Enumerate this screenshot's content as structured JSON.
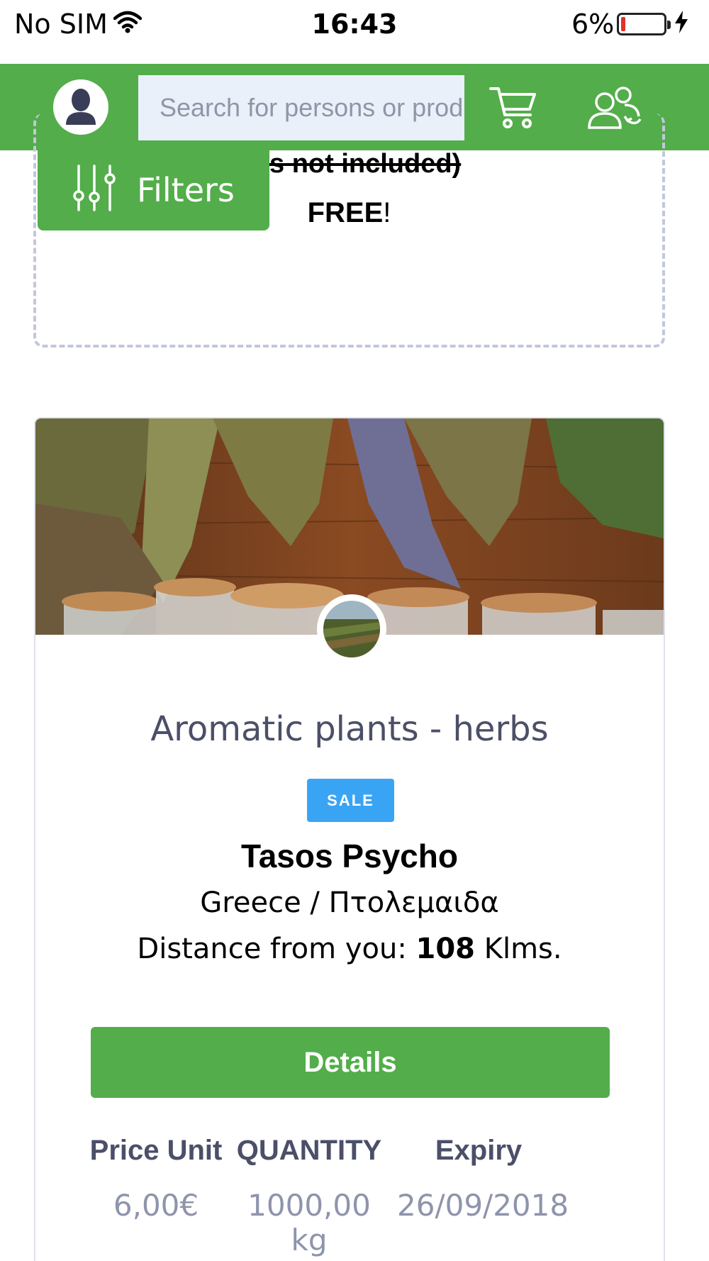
{
  "status_bar": {
    "carrier": "No SIM",
    "time": "16:43",
    "battery_percent": "6%",
    "battery_level": 0.06,
    "icons": [
      "wifi-icon",
      "battery-icon",
      "charging-bolt-icon"
    ]
  },
  "header": {
    "avatar_icon": "user-avatar-icon",
    "search_placeholder": "Search for persons or products",
    "cart_icon": "shopping-cart-icon",
    "switch_icon": "switch-users-icon",
    "accent_color": "#53ad4a"
  },
  "filters": {
    "label": "Filters",
    "icon": "sliders-icon"
  },
  "previous_card": {
    "shipping_text": "s not included)",
    "free_word": "FREE",
    "free_suffix": "!"
  },
  "product_card": {
    "title": "Aromatic plants - herbs",
    "badge": "SALE",
    "badge_color": "#3aa4f4",
    "seller": "Tasos Psycho",
    "location": "Greece / Πτολεμαιδα",
    "distance_prefix": "Distance from you: ",
    "distance_value": "108",
    "distance_suffix": " Klms.",
    "details_label": "Details",
    "columns": [
      "Price Unit",
      "QUANTITY",
      "Expiry"
    ],
    "values": [
      "6,00€",
      "1000,00 kg",
      "26/09/2018"
    ]
  }
}
